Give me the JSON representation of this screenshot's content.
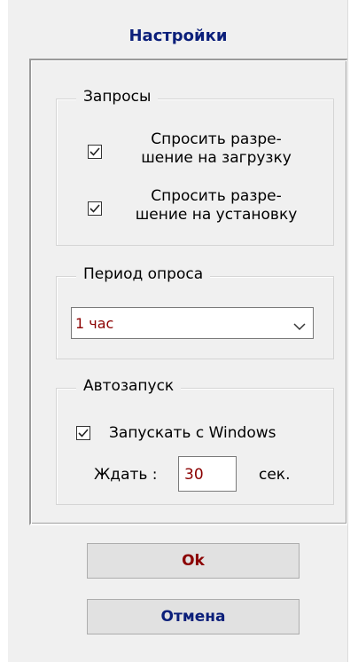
{
  "dialog": {
    "title": "Настройки"
  },
  "requests_group": {
    "title": "Запросы",
    "items": [
      {
        "label_line1": "Спросить разре-",
        "label_line2": "шение на загрузку",
        "checked": true
      },
      {
        "label_line1": "Спросить разре-",
        "label_line2": "шение на установку",
        "checked": true
      }
    ]
  },
  "poll_group": {
    "title": "Период опроса",
    "selected": "1 час"
  },
  "autostart_group": {
    "title": "Автозапуск",
    "run_with_windows_label": "Запускать с Windows",
    "run_with_windows_checked": true,
    "wait_label": "Ждать :",
    "wait_value": "30",
    "wait_unit": "сек."
  },
  "buttons": {
    "ok_label": "Ok",
    "cancel_label": "Отмена"
  },
  "colors": {
    "title": "#0b1f7a",
    "value_text": "#8b0000",
    "cancel_text": "#0b1f7a"
  }
}
